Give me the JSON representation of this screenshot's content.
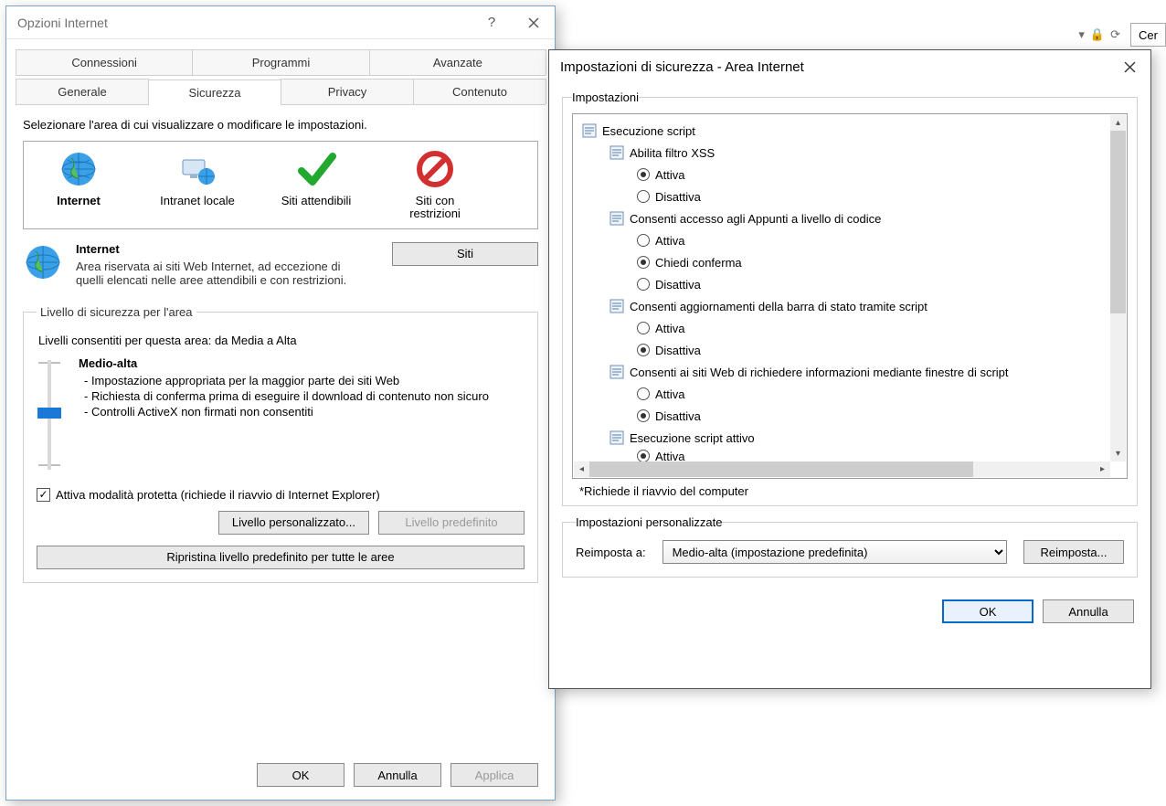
{
  "bg": {
    "search_placeholder": "Cer"
  },
  "dlg1": {
    "title": "Opzioni Internet",
    "tabs_row1": [
      "Connessioni",
      "Programmi",
      "Avanzate"
    ],
    "tabs_row2": [
      "Generale",
      "Sicurezza",
      "Privacy",
      "Contenuto"
    ],
    "active_tab": "Sicurezza",
    "zone_prompt": "Selezionare l'area di cui visualizzare o modificare le impostazioni.",
    "zones": {
      "internet": "Internet",
      "intranet": "Intranet locale",
      "trusted": "Siti attendibili",
      "restricted": "Siti con restrizioni"
    },
    "zone_name": "Internet",
    "zone_body": "Area riservata ai siti Web Internet, ad eccezione di quelli elencati nelle aree attendibili e con restrizioni.",
    "sites_btn": "Siti",
    "group_label": "Livello di sicurezza per l'area",
    "levels_allowed": "Livelli consentiti per questa area: da Media a Alta",
    "level_name": "Medio-alta",
    "bullets": [
      "- Impostazione appropriata per la maggior parte dei siti Web",
      "- Richiesta di conferma prima di eseguire il download di contenuto non sicuro",
      "- Controlli ActiveX non firmati non consentiti"
    ],
    "protected_mode": "Attiva modalità protetta (richiede il riavvio di Internet Explorer)",
    "custom_level_btn": "Livello personalizzato...",
    "default_level_btn": "Livello predefinito",
    "restore_all_btn": "Ripristina livello predefinito per tutte le aree",
    "ok": "OK",
    "cancel": "Annulla",
    "apply": "Applica"
  },
  "dlg2": {
    "title": "Impostazioni di sicurezza - Area Internet",
    "settings_legend": "Impostazioni",
    "tree": {
      "root": "Esecuzione script",
      "g1": "Abilita filtro XSS",
      "g2": "Consenti accesso agli Appunti a livello di codice",
      "g3": "Consenti aggiornamenti della barra di stato tramite script",
      "g4": "Consenti ai siti Web di richiedere informazioni mediante finestre di script",
      "g5": "Esecuzione script attivo",
      "enable": "Attiva",
      "disable": "Disattiva",
      "prompt": "Chiedi conferma"
    },
    "restart_note": "*Richiede il riavvio del computer",
    "custom_legend": "Impostazioni personalizzate",
    "reset_label": "Reimposta a:",
    "reset_value": "Medio-alta (impostazione predefinita)",
    "reset_btn": "Reimposta...",
    "ok": "OK",
    "cancel": "Annulla"
  }
}
